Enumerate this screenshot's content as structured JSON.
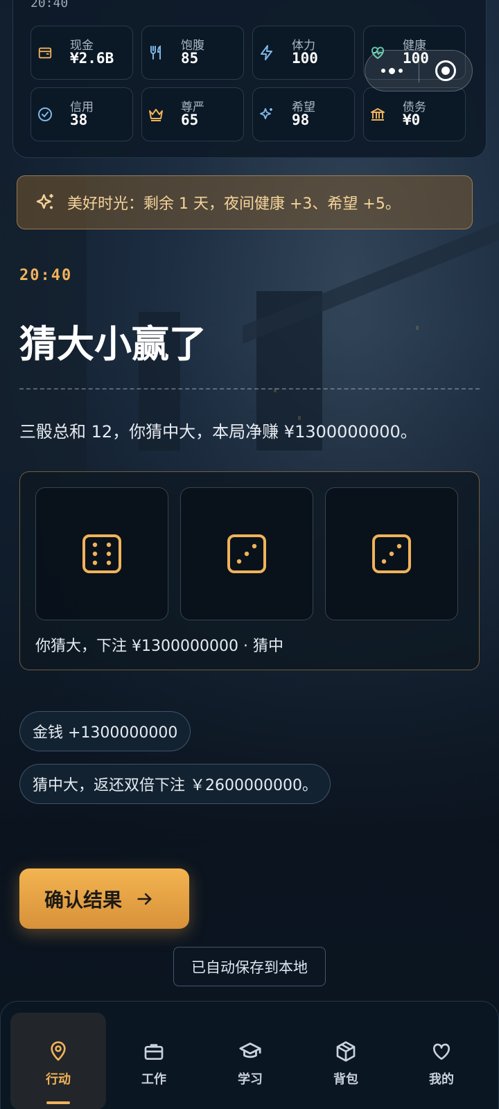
{
  "status": {
    "time": "20:40",
    "stats": [
      {
        "label": "现金",
        "value": "¥2.6B",
        "icon": "wallet-icon",
        "color": "#f0b35a"
      },
      {
        "label": "饱腹",
        "value": "85",
        "icon": "utensils-icon",
        "color": "#7fb7e6"
      },
      {
        "label": "体力",
        "value": "100",
        "icon": "lightning-icon",
        "color": "#7fb7e6"
      },
      {
        "label": "健康",
        "value": "100",
        "icon": "heart-pulse-icon",
        "color": "#5fc7a8"
      },
      {
        "label": "信用",
        "value": "38",
        "icon": "badge-check-icon",
        "color": "#7fb7e6"
      },
      {
        "label": "尊严",
        "value": "65",
        "icon": "crown-icon",
        "color": "#f0b35a"
      },
      {
        "label": "希望",
        "value": "98",
        "icon": "sparkles-icon",
        "color": "#7fb7e6"
      },
      {
        "label": "债务",
        "value": "¥0",
        "icon": "bank-icon",
        "color": "#f0b35a"
      }
    ]
  },
  "buff": {
    "icon": "sparkles-icon",
    "text": "美好时光：剩余 1 天，夜间健康 +3、希望 +5。"
  },
  "event": {
    "time": "20:40",
    "title": "猜大小赢了",
    "description": "三骰总和 12，你猜中大，本局净赚 ¥1300000000。",
    "dice": [
      6,
      3,
      3
    ],
    "dice_caption": "你猜大，下注 ¥1300000000 · 猜中"
  },
  "effects": [
    "金钱 +1300000000",
    "猜中大，返还双倍下注 ￥2600000000。"
  ],
  "confirm_label": "确认结果",
  "save_status": "已自动保存到本地",
  "tabs": [
    {
      "label": "行动",
      "icon": "location-pin-icon",
      "active": true
    },
    {
      "label": "工作",
      "icon": "briefcase-icon",
      "active": false
    },
    {
      "label": "学习",
      "icon": "graduation-cap-icon",
      "active": false
    },
    {
      "label": "背包",
      "icon": "box-icon",
      "active": false
    },
    {
      "label": "我的",
      "icon": "heart-icon",
      "active": false
    }
  ],
  "colors": {
    "accent": "#f0b35a",
    "background": "#0b1622",
    "panel_border": "#2c3d50"
  }
}
